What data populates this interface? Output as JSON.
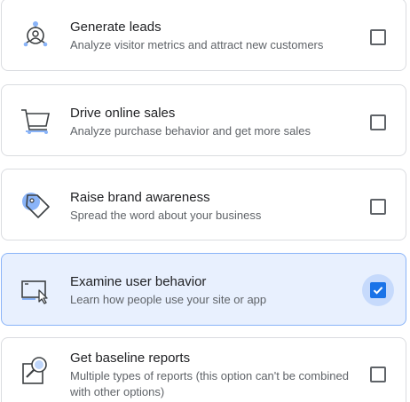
{
  "options": [
    {
      "title": "Generate leads",
      "description": "Analyze visitor metrics and attract new customers",
      "icon": "person-target-icon",
      "checked": false
    },
    {
      "title": "Drive online sales",
      "description": "Analyze purchase behavior and get more sales",
      "icon": "shopping-cart-icon",
      "checked": false
    },
    {
      "title": "Raise brand awareness",
      "description": "Spread the word about your business",
      "icon": "tag-icon",
      "checked": false
    },
    {
      "title": "Examine user behavior",
      "description": "Learn how people use your site or app",
      "icon": "browser-cursor-icon",
      "checked": true
    },
    {
      "title": "Get baseline reports",
      "description": "Multiple types of reports (this option can't be combined with other options)",
      "icon": "magnifier-report-icon",
      "checked": false
    }
  ],
  "colors": {
    "accent": "#1a73e8",
    "selected_background": "#e8f0fe",
    "selected_border": "#8ab4f8",
    "icon_blue": "#8ab4f8"
  }
}
